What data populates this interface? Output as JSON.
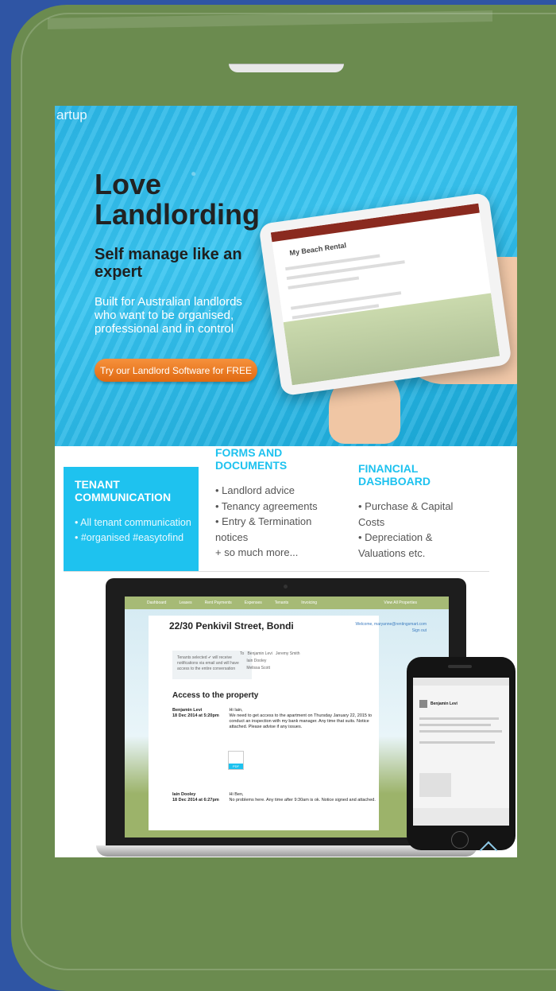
{
  "hero": {
    "brand_fragment": "artup",
    "title": "Love Landlording",
    "subtitle": "Self manage like an expert",
    "text": "Built for Australian landlords who want to be organised, professional and in control",
    "cta": "Try our Landlord Software for FREE",
    "tablet_title": "My Beach Rental"
  },
  "features": {
    "tenant": {
      "heading": "TENANT COMMUNICATION",
      "lines": [
        "• All tenant communication",
        "• #organised #easytofind"
      ]
    },
    "forms": {
      "heading": "FORMS AND DOCUMENTS",
      "lines": [
        "• Landlord advice",
        "• Tenancy agreements",
        "• Entry & Termination notices",
        "+ so much more..."
      ]
    },
    "financial": {
      "heading": "FINANCIAL DASHBOARD",
      "lines": [
        "• Purchase & Capital Costs",
        "• Depreciation & Valuations etc."
      ]
    }
  },
  "laptop": {
    "nav": [
      "Dashboard",
      "Leases",
      "Rent Payments",
      "Expenses",
      "Tenants",
      "Invoicing",
      "View All Properties"
    ],
    "address": "22/30 Penkivil Street, Bondi",
    "welcome": "Welcome, maryanne@rentingsmart.com",
    "signout": "Sign out",
    "notice": "Tenants selected ✔ will receive notifications via email and will have access to the entire conversation",
    "to_label": "To",
    "tenants": [
      "Benjamin Levi",
      "Jeremy Smith",
      "Iain Dooley",
      "Melissa Scott"
    ],
    "subject": "Access to the property",
    "msg1": {
      "author": "Benjamin Levi",
      "date": "18 Dec 2014 at 5:20pm",
      "greeting": "Hi Iain,",
      "body": "We need to get access to the apartment on Thursday January 22, 2015 to conduct an inspection with my bank manager. Any time that suits. Notice attached. Please advise if any issues."
    },
    "attachment": "PDF",
    "msg2": {
      "author": "Iain Dooley",
      "date": "18 Dec 2014 at 6:27pm",
      "greeting": "Hi Ben,",
      "body": "No problems here. Any time after 9:30am is ok. Notice signed and attached."
    }
  },
  "iphone": {
    "sender": "Benjamin Levi"
  },
  "colors": {
    "page_bg": "#2f55a4",
    "phone_body": "#6b8b4f",
    "accent": "#1ec2ef",
    "cta": "#f07f25"
  }
}
